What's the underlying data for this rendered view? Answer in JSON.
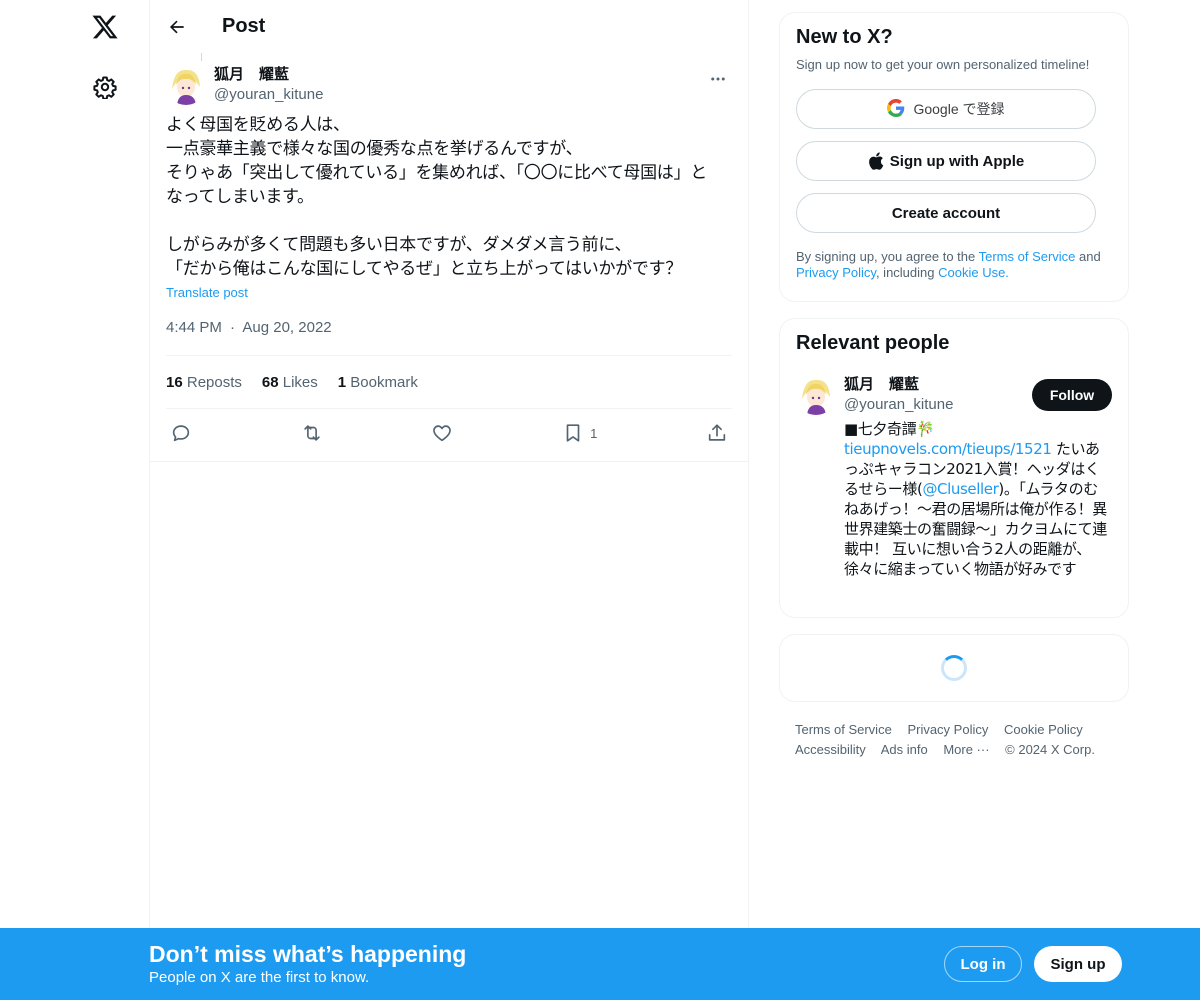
{
  "nav": {
    "logo_icon": "x-logo-icon",
    "settings_icon": "gear-icon"
  },
  "header": {
    "back_icon": "arrow-left-icon",
    "title": "Post"
  },
  "post": {
    "author": {
      "display_name": "狐月　耀藍",
      "handle": "@youran_kitune"
    },
    "text": "よく母国を貶める人は、\n一点豪華主義で様々な国の優秀な点を挙げるんですが、\nそりゃあ「突出して優れている」を集めれば、「〇〇に比べて母国は」と\nなってしまいます。\n\nしがらみが多くて問題も多い日本ですが、ダメダメ言う前に、\n「だから俺はこんな国にしてやるぜ」と立ち上がってはいかがです？",
    "translate_label": "Translate post",
    "time": "4:44 PM",
    "separator": "·",
    "date": "Aug 20, 2022",
    "stats": {
      "reposts_count": "16",
      "reposts_label": "Reposts",
      "likes_count": "68",
      "likes_label": "Likes",
      "bookmarks_count": "1",
      "bookmarks_label": "Bookmark"
    },
    "actions": {
      "bookmark_count": "1"
    }
  },
  "sidebar": {
    "new_to_x": {
      "title": "New to X?",
      "subtitle": "Sign up now to get your own personalized timeline!",
      "google_label": "Google で登録",
      "apple_label": "Sign up with Apple",
      "create_label": "Create account",
      "terms_prefix": "By signing up, you agree to the ",
      "terms_link": "Terms of Service",
      "terms_and": " and ",
      "privacy_link": "Privacy Policy",
      "terms_including": ", including ",
      "cookie_link": "Cookie Use."
    },
    "relevant_people": {
      "title": "Relevant people",
      "person": {
        "display_name": "狐月　耀藍",
        "handle": "@youran_kitune",
        "follow_label": "Follow",
        "bio_line1": "■七夕奇譚🎋",
        "bio_link1": "tieupnovels.com/tieups/1521",
        "bio_mid": " たいあっぷキャラコン2021入賞！ヘッダはくるせらー様(",
        "bio_link2": "@Cluseller",
        "bio_rest": ")。「ムラタのむねあげっ！〜君の居場所は俺が作る！異世界建築士の奮闘録〜」カクヨムにて連載中！ 互いに想い合う2人の距離が、徐々に縮まっていく物語が好みです"
      }
    },
    "footer": {
      "terms": "Terms of Service",
      "privacy": "Privacy Policy",
      "cookie": "Cookie Policy",
      "accessibility": "Accessibility",
      "ads": "Ads info",
      "more": "More ···",
      "copyright": "© 2024 X Corp."
    }
  },
  "banner": {
    "title": "Don’t miss what’s happening",
    "subtitle": "People on X are the first to know.",
    "login_label": "Log in",
    "signup_label": "Sign up"
  },
  "colors": {
    "accent": "#1d9bf0",
    "text": "#0f1419",
    "muted": "#536471"
  }
}
